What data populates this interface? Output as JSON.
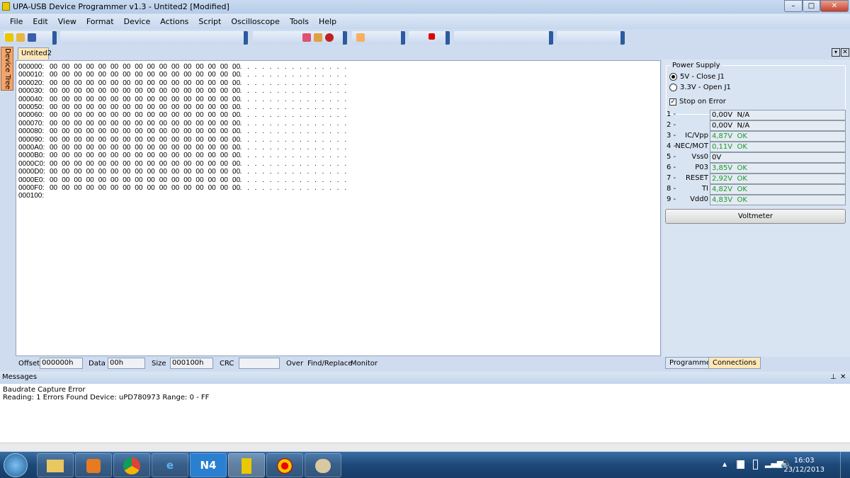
{
  "window": {
    "title": "UPA-USB Device Programmer v1.3 - Untited2 [Modified]",
    "min": "–",
    "max": "□",
    "close": "✕"
  },
  "menu": [
    "File",
    "Edit",
    "View",
    "Format",
    "Device",
    "Actions",
    "Script",
    "Oscilloscope",
    "Tools",
    "Help"
  ],
  "side_tab": "Device Tree",
  "doc_tab": "Untited2",
  "hex": {
    "rows": [
      {
        "addr": "000000:",
        "bytes": "00 00 00 00 00 00 00 00 00 00 00 00 00 00 00 00",
        "ascii": ". . . . . . . . . . . . . . . ."
      },
      {
        "addr": "000010:",
        "bytes": "00 00 00 00 00 00 00 00 00 00 00 00 00 00 00 00",
        "ascii": ". . . . . . . . . . . . . . . ."
      },
      {
        "addr": "000020:",
        "bytes": "00 00 00 00 00 00 00 00 00 00 00 00 00 00 00 00",
        "ascii": ". . . . . . . . . . . . . . . ."
      },
      {
        "addr": "000030:",
        "bytes": "00 00 00 00 00 00 00 00 00 00 00 00 00 00 00 00",
        "ascii": ". . . . . . . . . . . . . . . ."
      },
      {
        "addr": "000040:",
        "bytes": "00 00 00 00 00 00 00 00 00 00 00 00 00 00 00 00",
        "ascii": ". . . . . . . . . . . . . . . ."
      },
      {
        "addr": "000050:",
        "bytes": "00 00 00 00 00 00 00 00 00 00 00 00 00 00 00 00",
        "ascii": ". . . . . . . . . . . . . . . ."
      },
      {
        "addr": "000060:",
        "bytes": "00 00 00 00 00 00 00 00 00 00 00 00 00 00 00 00",
        "ascii": ". . . . . . . . . . . . . . . ."
      },
      {
        "addr": "000070:",
        "bytes": "00 00 00 00 00 00 00 00 00 00 00 00 00 00 00 00",
        "ascii": ". . . . . . . . . . . . . . . ."
      },
      {
        "addr": "000080:",
        "bytes": "00 00 00 00 00 00 00 00 00 00 00 00 00 00 00 00",
        "ascii": ". . . . . . . . . . . . . . . ."
      },
      {
        "addr": "000090:",
        "bytes": "00 00 00 00 00 00 00 00 00 00 00 00 00 00 00 00",
        "ascii": ". . . . . . . . . . . . . . . ."
      },
      {
        "addr": "0000A0:",
        "bytes": "00 00 00 00 00 00 00 00 00 00 00 00 00 00 00 00",
        "ascii": ". . . . . . . . . . . . . . . ."
      },
      {
        "addr": "0000B0:",
        "bytes": "00 00 00 00 00 00 00 00 00 00 00 00 00 00 00 00",
        "ascii": ". . . . . . . . . . . . . . . ."
      },
      {
        "addr": "0000C0:",
        "bytes": "00 00 00 00 00 00 00 00 00 00 00 00 00 00 00 00",
        "ascii": ". . . . . . . . . . . . . . . ."
      },
      {
        "addr": "0000D0:",
        "bytes": "00 00 00 00 00 00 00 00 00 00 00 00 00 00 00 00",
        "ascii": ". . . . . . . . . . . . . . . ."
      },
      {
        "addr": "0000E0:",
        "bytes": "00 00 00 00 00 00 00 00 00 00 00 00 00 00 00 00",
        "ascii": ". . . . . . . . . . . . . . . ."
      },
      {
        "addr": "0000F0:",
        "bytes": "00 00 00 00 00 00 00 00 00 00 00 00 00 00 00 00",
        "ascii": ". . . . . . . . . . . . . . . ."
      },
      {
        "addr": "000100:",
        "bytes": "",
        "ascii": ""
      }
    ]
  },
  "status": {
    "offset_label": "Offset",
    "offset": "000000h",
    "data_label": "Data",
    "data": "00h",
    "size_label": "Size",
    "size": "000100h",
    "crc_label": "CRC",
    "crc": "",
    "over": "Over",
    "find": "Find/Replace",
    "monitor": "Monitor"
  },
  "power": {
    "title": "Power Supply",
    "opt1": "5V - Close J1",
    "opt2": "3.3V - Open J1",
    "selected": "5V - Close J1",
    "stop_on_error": "Stop on Error",
    "stop_checked": true
  },
  "pins": [
    {
      "num": "1 -",
      "label": "",
      "value": "0,00V  N/A",
      "ok": false
    },
    {
      "num": "2 -",
      "label": "",
      "value": "0,00V  N/A",
      "ok": false
    },
    {
      "num": "3 -",
      "label": "IC/Vpp",
      "value": "4,87V  OK",
      "ok": true
    },
    {
      "num": "4 -",
      "label": "NEC/MOT",
      "value": "0,11V  OK",
      "ok": true
    },
    {
      "num": "5 -",
      "label": "Vss0",
      "value": "0V",
      "ok": false
    },
    {
      "num": "6 -",
      "label": "P03",
      "value": "3,85V  OK",
      "ok": true
    },
    {
      "num": "7 -",
      "label": "RESET",
      "value": "2,92V  OK",
      "ok": true
    },
    {
      "num": "8 -",
      "label": "TI",
      "value": "4,82V  OK",
      "ok": true
    },
    {
      "num": "9 -",
      "label": "Vdd0",
      "value": "4,83V  OK",
      "ok": true
    }
  ],
  "voltmeter": "Voltmeter",
  "panel_tabs": [
    "Programmer",
    "Connections"
  ],
  "messages": {
    "title": "Messages",
    "lines": [
      "Baudrate Capture Error",
      "Reading:  1 Errors Found   Device: uPD780973 Range: 0 - FF"
    ]
  },
  "taskbar": {
    "apps": [
      "start",
      "explorer",
      "media-player",
      "chrome",
      "internet-explorer",
      "N4",
      "chip-programmer",
      "target-app",
      "paint"
    ],
    "n4": "N4",
    "time": "16:03",
    "date": "23/12/2013"
  },
  "colors": {
    "ok": "#1a9a2a",
    "active_tab": "#ffe7b8",
    "side_tab": "#f4a46a"
  }
}
